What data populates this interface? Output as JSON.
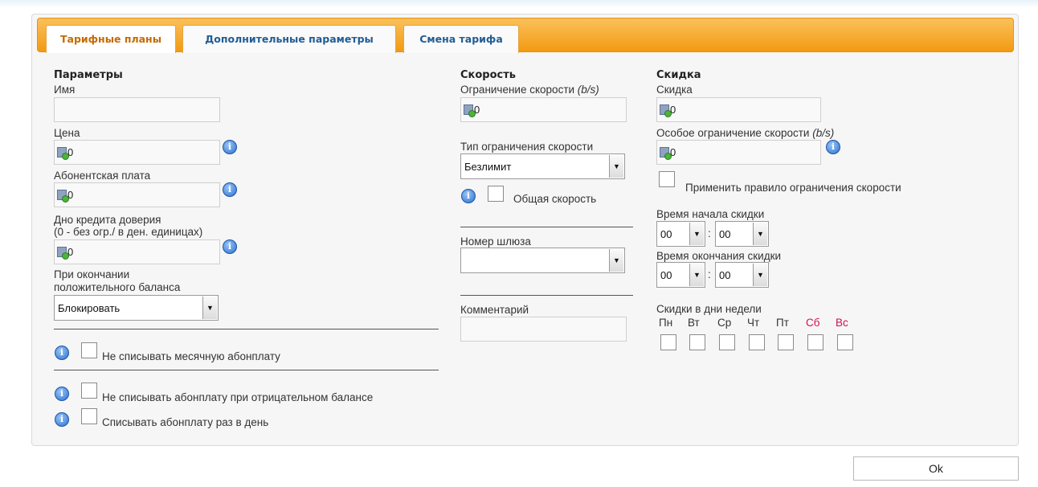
{
  "tabs": [
    {
      "label": "Тарифные планы"
    },
    {
      "label": "Дополнительные параметры"
    },
    {
      "label": "Смена тарифа"
    }
  ],
  "params": {
    "header": "Параметры",
    "name_label": "Имя",
    "name_value": "",
    "price_label": "Цена",
    "price_value": "0",
    "fee_label": "Абонентская плата",
    "fee_value": "0",
    "credit_label_1": "Дно кредита доверия",
    "credit_label_2": "(0 - без огр./ в ден. единицах)",
    "credit_value": "0",
    "balance_label_1": "При окончании",
    "balance_label_2": "положительного баланса",
    "balance_select": "Блокировать",
    "no_monthly_fee_label": "Не списывать месячную абонплату",
    "no_fee_negative_label": "Не списывать абонплату при отрицательном балансе",
    "daily_fee_label": "Списывать абонплату раз в день"
  },
  "speed": {
    "header": "Скорость",
    "limit_label_prefix": "Ограничение скорости ",
    "limit_label_unit": "(b/s)",
    "limit_value": "0",
    "type_label": "Тип ограничения скорости",
    "type_select": "Безлимит",
    "shared_label": "Общая скорость",
    "gateway_label": "Номер шлюза",
    "gateway_select": "",
    "comment_label": "Комментарий",
    "comment_value": ""
  },
  "discount": {
    "header": "Скидка",
    "discount_label": "Скидка",
    "discount_value": "0",
    "special_limit_prefix": "Особое ограничение скорости ",
    "special_limit_unit": "(b/s)",
    "special_limit_value": "0",
    "apply_rule_label": "Применить правило ограничения скорости",
    "start_label": "Время начала скидки",
    "start_hour": "00",
    "start_min": "00",
    "end_label": "Время окончания скидки",
    "end_hour": "00",
    "end_min": "00",
    "colon": ":",
    "days_label": "Скидки в дни недели",
    "days": [
      "Пн",
      "Вт",
      "Ср",
      "Чт",
      "Пт",
      "Сб",
      "Вс"
    ]
  },
  "ok_label": "Ok",
  "colors": {
    "tab_bar": "#f29a13",
    "tab_active_text": "#c66a00",
    "tab_text": "#225c96",
    "weekend": "#d0104a"
  }
}
